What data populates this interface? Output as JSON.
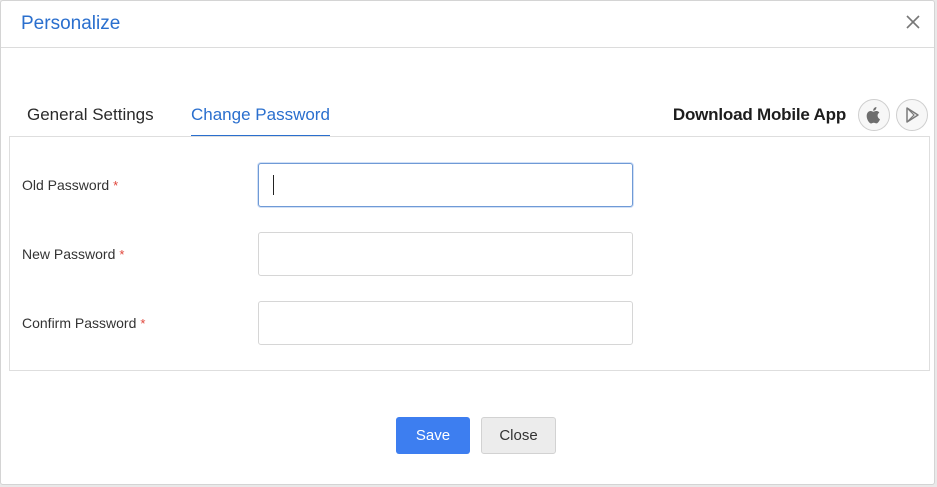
{
  "dialog": {
    "title": "Personalize",
    "close_icon": "close-icon"
  },
  "tabs": [
    {
      "label": "General Settings",
      "active": false
    },
    {
      "label": "Change Password",
      "active": true
    }
  ],
  "download": {
    "label": "Download Mobile App",
    "icons": [
      "apple-icon",
      "google-play-icon"
    ]
  },
  "form": {
    "fields": [
      {
        "label": "Old Password",
        "required_mark": "*",
        "value": "",
        "focused": true
      },
      {
        "label": "New Password",
        "required_mark": "*",
        "value": "",
        "focused": false
      },
      {
        "label": "Confirm Password",
        "required_mark": "*",
        "value": "",
        "focused": false
      }
    ]
  },
  "actions": {
    "save_label": "Save",
    "close_label": "Close"
  },
  "colors": {
    "accent": "#2a6fce",
    "primary_button": "#3d7ef0",
    "required": "#e0453a"
  }
}
